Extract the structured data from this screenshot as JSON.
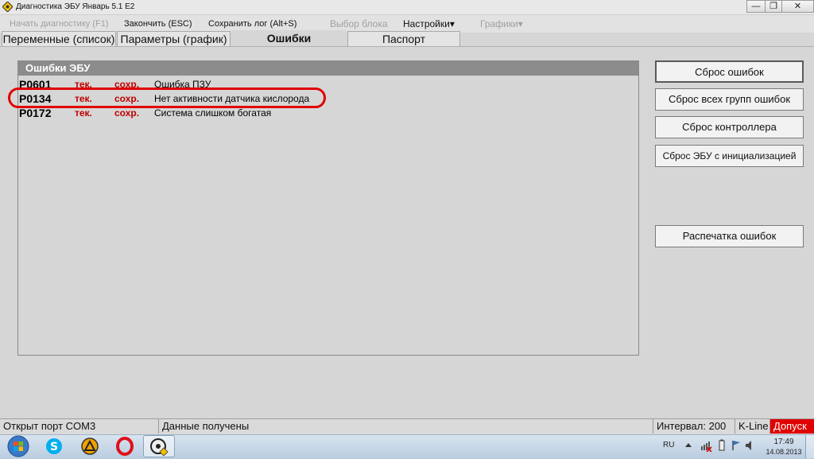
{
  "window": {
    "title": "Диагностика ЭБУ Январь 5.1 E2",
    "minimize_glyph": "—",
    "maximize_glyph": "❐",
    "close_glyph": "✕"
  },
  "menu": {
    "start_diag": "Начать диагностику (F1)",
    "finish": "Закончить (ESC)",
    "save_log": "Сохранить лог (Alt+S)",
    "select_block": "Выбор блока",
    "settings": "Настройки▾",
    "charts": "Графики▾"
  },
  "tabs": [
    {
      "label": "Переменные (список)"
    },
    {
      "label": "Параметры (график)"
    },
    {
      "label": "Ошибки"
    },
    {
      "label": "Паспорт"
    }
  ],
  "errors_panel": {
    "title": "Ошибки ЭБУ",
    "rows": [
      {
        "code": "P0601",
        "current": "тек.",
        "saved": "сохр.",
        "description": "Ошибка ПЗУ"
      },
      {
        "code": "P0134",
        "current": "тек.",
        "saved": "сохр.",
        "description": "Нет активности датчика кислорода"
      },
      {
        "code": "P0172",
        "current": "тек.",
        "saved": "сохр.",
        "description": "Система слишком богатая"
      }
    ]
  },
  "actions": {
    "reset_errors": "Сброс ошибок",
    "reset_all_groups": "Сброс всех групп ошибок",
    "reset_controller": "Сброс контроллера",
    "reset_ecu_init": "Сброс ЭБУ с инициализацией",
    "print_errors": "Распечатка ошибок"
  },
  "status": {
    "port": "Открыт порт COM3",
    "data": "Данные получены",
    "interval": "Интервал: 200",
    "line": "K-Line",
    "allowed": "Допуск"
  },
  "taskbar": {
    "lang": "RU",
    "time": "17:49",
    "date": "14.08.2013"
  },
  "colors": {
    "error_red": "#c00000",
    "highlight_red": "#e00000",
    "header_gray": "#8c8c8c"
  }
}
